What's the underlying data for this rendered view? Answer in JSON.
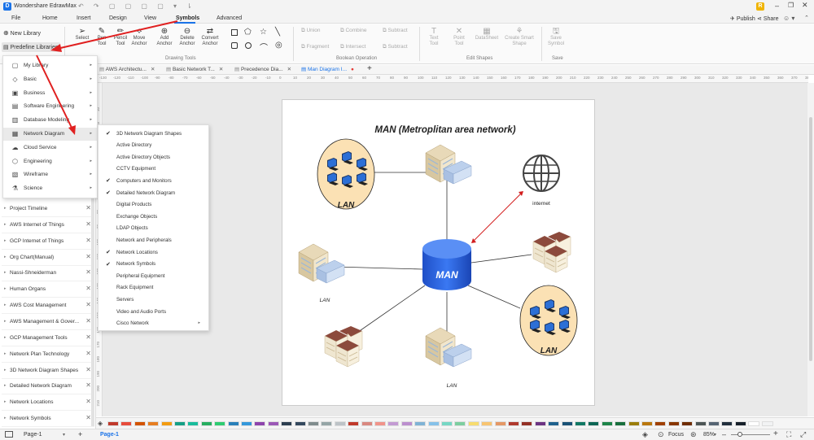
{
  "app": {
    "title": "Wondershare EdrawMax",
    "user_initial": "R"
  },
  "menu": {
    "items": [
      "File",
      "Home",
      "Insert",
      "Design",
      "View",
      "Symbols",
      "Advanced"
    ],
    "active": "Symbols",
    "right": {
      "publish": "Publish",
      "share": "Share"
    }
  },
  "ribbon": {
    "left_buttons": {
      "new_library": "New Library",
      "predefine_libraries": "Predefine Libraries"
    },
    "drawing_tools": [
      {
        "icon": "select-icon",
        "label": "Select"
      },
      {
        "icon": "pen-icon",
        "label": "Pen\nTool"
      },
      {
        "icon": "pencil-icon",
        "label": "Pencil\nTool"
      },
      {
        "icon": "move-anchor-icon",
        "label": "Move\nAnchor"
      },
      {
        "icon": "add-anchor-icon",
        "label": "Add\nAnchor"
      },
      {
        "icon": "delete-anchor-icon",
        "label": "Delete\nAnchor"
      },
      {
        "icon": "convert-anchor-icon",
        "label": "Convert\nAnchor"
      }
    ],
    "drawing_tools_group": "Drawing Tools",
    "boolean_ops": [
      {
        "label": "Union"
      },
      {
        "label": "Combine"
      },
      {
        "label": "Subtract"
      },
      {
        "label": "Fragment"
      },
      {
        "label": "Intersect"
      },
      {
        "label": "Subtract"
      }
    ],
    "boolean_group": "Boolean Operation",
    "edit_shapes": [
      {
        "label": "Text\nTool"
      },
      {
        "label": "Point\nTool"
      },
      {
        "label": "DataSheet"
      },
      {
        "label": "Create Smart\nShape"
      }
    ],
    "edit_shapes_group": "Edit Shapes",
    "save": {
      "label": "Save\nSymbol",
      "group": "Save"
    }
  },
  "predefine_menu": [
    {
      "icon": "library-icon",
      "label": "My Library"
    },
    {
      "icon": "tag-icon",
      "label": "Basic"
    },
    {
      "icon": "briefcase-icon",
      "label": "Business"
    },
    {
      "icon": "software-icon",
      "label": "Software Engineering"
    },
    {
      "icon": "database-icon",
      "label": "Database Modeling"
    },
    {
      "icon": "network-icon",
      "label": "Network Diagram"
    },
    {
      "icon": "cloud-icon",
      "label": "Cloud Service"
    },
    {
      "icon": "engineering-icon",
      "label": "Engineering"
    },
    {
      "icon": "wireframe-icon",
      "label": "Wireframe"
    },
    {
      "icon": "science-icon",
      "label": "Science"
    }
  ],
  "network_submenu": [
    {
      "label": "3D Network Diagram Shapes",
      "checked": true
    },
    {
      "label": "Active Directory",
      "checked": false
    },
    {
      "label": "Active Directory Objects",
      "checked": false
    },
    {
      "label": "CCTV Equipment",
      "checked": false
    },
    {
      "label": "Computers and Monitors",
      "checked": true
    },
    {
      "label": "Detailed Network Diagram",
      "checked": true
    },
    {
      "label": "Digital Products",
      "checked": false
    },
    {
      "label": "Exchange Objects",
      "checked": false
    },
    {
      "label": "LDAP Objects",
      "checked": false
    },
    {
      "label": "Network and Peripherals",
      "checked": false
    },
    {
      "label": "Network Locations",
      "checked": true
    },
    {
      "label": "Network Symbols",
      "checked": true
    },
    {
      "label": "Peripheral Equipment",
      "checked": false
    },
    {
      "label": "Rack Equipment",
      "checked": false
    },
    {
      "label": "Servers",
      "checked": false
    },
    {
      "label": "Video and Audio Ports",
      "checked": false
    },
    {
      "label": "Cisco Network",
      "checked": false,
      "has_sub": true
    }
  ],
  "libraries": [
    "Project Timeline",
    "AWS Internet of Things",
    "GCP Internet of Things",
    "Org Chart(Manual)",
    "Nassi-Shneiderman",
    "Human Organs",
    "AWS Cost Management",
    "AWS Management & Gover...",
    "GCP Management Tools",
    "Network Plan Technology",
    "3D Network Diagram Shapes",
    "Detailed Network Diagram",
    "Network Locations",
    "Network Symbols"
  ],
  "tabs": [
    {
      "label": "AWS Architectu...",
      "active": false
    },
    {
      "label": "Basic Network T...",
      "active": false
    },
    {
      "label": "Precedence Dia...",
      "active": false
    },
    {
      "label": "Man Diagram I...",
      "active": true
    }
  ],
  "ruler_labels": [
    "-130",
    "-120",
    "-110",
    "-100",
    "-90",
    "-80",
    "-70",
    "-60",
    "-50",
    "-40",
    "-30",
    "-20",
    "-10",
    "0",
    "10",
    "20",
    "30",
    "40",
    "50",
    "60",
    "70",
    "80",
    "90",
    "100",
    "110",
    "120",
    "130",
    "140",
    "150",
    "160",
    "170",
    "180",
    "190",
    "200",
    "210",
    "220",
    "230",
    "240",
    "250",
    "260",
    "270",
    "280",
    "290",
    "300",
    "310",
    "320",
    "330",
    "340",
    "350",
    "360",
    "370",
    "380"
  ],
  "vruler_labels": [
    "10",
    "20",
    "30",
    "40",
    "50",
    "60",
    "70",
    "80",
    "90",
    "100",
    "110",
    "120",
    "130",
    "140",
    "150",
    "160",
    "170",
    "180",
    "190",
    "200",
    "210"
  ],
  "diagram": {
    "title": "MAN (Metroplitan area network)",
    "center_label": "MAN",
    "lan_label": "LAN",
    "internet_label": "internet",
    "small_lan_left": "LAN",
    "small_lan_bottom": "LAN"
  },
  "status": {
    "page_selector": "Page-1",
    "page_tab": "Page-1",
    "focus": "Focus",
    "zoom": "85%"
  },
  "palette_colors": [
    "#c0392b",
    "#e74c3c",
    "#d35400",
    "#e67e22",
    "#f39c12",
    "#16a085",
    "#1abc9c",
    "#27ae60",
    "#2ecc71",
    "#2980b9",
    "#3498db",
    "#8e44ad",
    "#9b59b6",
    "#2c3e50",
    "#34495e",
    "#7f8c8d",
    "#95a5a6",
    "#bdc3c7",
    "#c0392b",
    "#d98880",
    "#f1948a",
    "#c39bd3",
    "#bb8fce",
    "#7fb3d5",
    "#85c1e9",
    "#76d7c4",
    "#7dcea0",
    "#f7dc6f",
    "#f8c471",
    "#e59866",
    "#b03a2e",
    "#943126",
    "#6c3483",
    "#1f618d",
    "#1a5276",
    "#117864",
    "#0e6655",
    "#1e8449",
    "#196f3d",
    "#9a7d0a",
    "#b9770e",
    "#a04000",
    "#873600",
    "#6e2c00",
    "#4d5656",
    "#566573",
    "#212f3d",
    "#17202a",
    "#ffffff",
    "#f2f3f4"
  ]
}
